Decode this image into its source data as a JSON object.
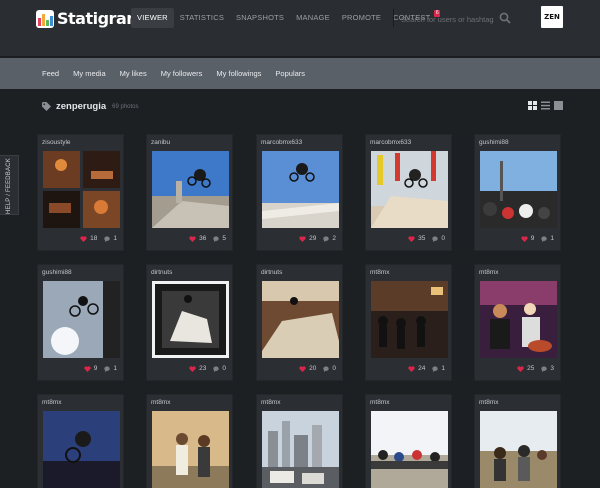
{
  "app": {
    "logo_text": "Statigram",
    "avatar_text": "ZEN"
  },
  "nav": {
    "items": [
      "VIEWER",
      "STATISTICS",
      "SNAPSHOTS",
      "MANAGE",
      "PROMOTE",
      "CONTEST"
    ],
    "active_index": 0,
    "contest_badge": "6"
  },
  "search": {
    "placeholder": "Search for users or hashtags"
  },
  "subnav": {
    "items": [
      "Feed",
      "My media",
      "My likes",
      "My followers",
      "My followings",
      "Populars"
    ]
  },
  "tag": {
    "name": "zenperugia",
    "count": "69 photos"
  },
  "feedback_label": "HELP / FEEDBACK",
  "colors": {
    "accent_like": "#d9274b",
    "topbar": "#2a2d31",
    "subnav": "#5a6068",
    "card": "#2b2e32"
  },
  "photos": [
    {
      "user": "zisoustyle",
      "likes": "18",
      "comments": "1",
      "scene": "collage"
    },
    {
      "user": "zanibu",
      "likes": "36",
      "comments": "5",
      "scene": "sky-ramp"
    },
    {
      "user": "marcobmx633",
      "likes": "29",
      "comments": "2",
      "scene": "sky-rail"
    },
    {
      "user": "marcobmx633",
      "likes": "35",
      "comments": "0",
      "scene": "ramp-flags"
    },
    {
      "user": "gushimi88",
      "likes": "9",
      "comments": "1",
      "scene": "crowd-sky"
    },
    {
      "user": "gushimi88",
      "likes": "9",
      "comments": "1",
      "scene": "silhouette"
    },
    {
      "user": "dirtnuts",
      "likes": "23",
      "comments": "0",
      "scene": "polaroid"
    },
    {
      "user": "dirtnuts",
      "likes": "20",
      "comments": "0",
      "scene": "wall-ride"
    },
    {
      "user": "mt8mx",
      "likes": "24",
      "comments": "1",
      "scene": "night-crowd"
    },
    {
      "user": "mt8mx",
      "likes": "25",
      "comments": "3",
      "scene": "concert"
    },
    {
      "user": "mt8mx",
      "likes": "",
      "comments": "",
      "scene": "blue-rider"
    },
    {
      "user": "mt8mx",
      "likes": "",
      "comments": "",
      "scene": "people-street"
    },
    {
      "user": "mt8mx",
      "likes": "",
      "comments": "",
      "scene": "city"
    },
    {
      "user": "mt8mx",
      "likes": "",
      "comments": "",
      "scene": "bikes-crowd"
    },
    {
      "user": "mt8mx",
      "likes": "",
      "comments": "",
      "scene": "band-outdoor"
    }
  ]
}
